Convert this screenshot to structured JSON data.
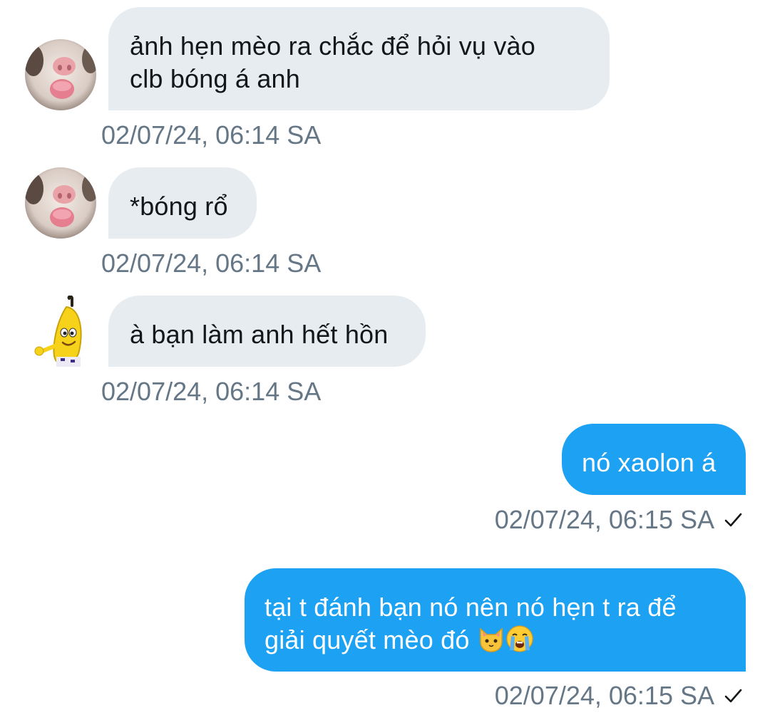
{
  "conversation": {
    "messages": [
      {
        "sender": "other",
        "avatar_icon": "hamster-avatar",
        "text": "ảnh hẹn mèo ra chắc để hỏi vụ vào\nclb bóng á anh",
        "timestamp": "02/07/24, 06:14 SA"
      },
      {
        "sender": "other",
        "avatar_icon": "hamster-avatar",
        "text": "*bóng rổ",
        "timestamp": "02/07/24, 06:14 SA"
      },
      {
        "sender": "other",
        "avatar_icon": "banana-avatar",
        "text": "à bạn làm anh hết hồn",
        "timestamp": "02/07/24, 06:14 SA"
      },
      {
        "sender": "me",
        "text": "nó xaolon á",
        "timestamp": "02/07/24, 06:15 SA",
        "status_icon": "checkmark-icon"
      },
      {
        "sender": "me",
        "text": "tại t đánh bạn nó nên nó hẹn t ra để\ngiải quyết mèo đó",
        "emojis": [
          "cat-face-icon",
          "crying-face-icon"
        ],
        "timestamp": "02/07/24, 06:15 SA",
        "status_icon": "checkmark-icon"
      }
    ]
  },
  "colors": {
    "incoming_bubble": "#e6ecf0",
    "outgoing_bubble": "#1da1f2",
    "timestamp_text": "#657786",
    "incoming_text": "#14171a",
    "outgoing_text": "#ffffff"
  }
}
